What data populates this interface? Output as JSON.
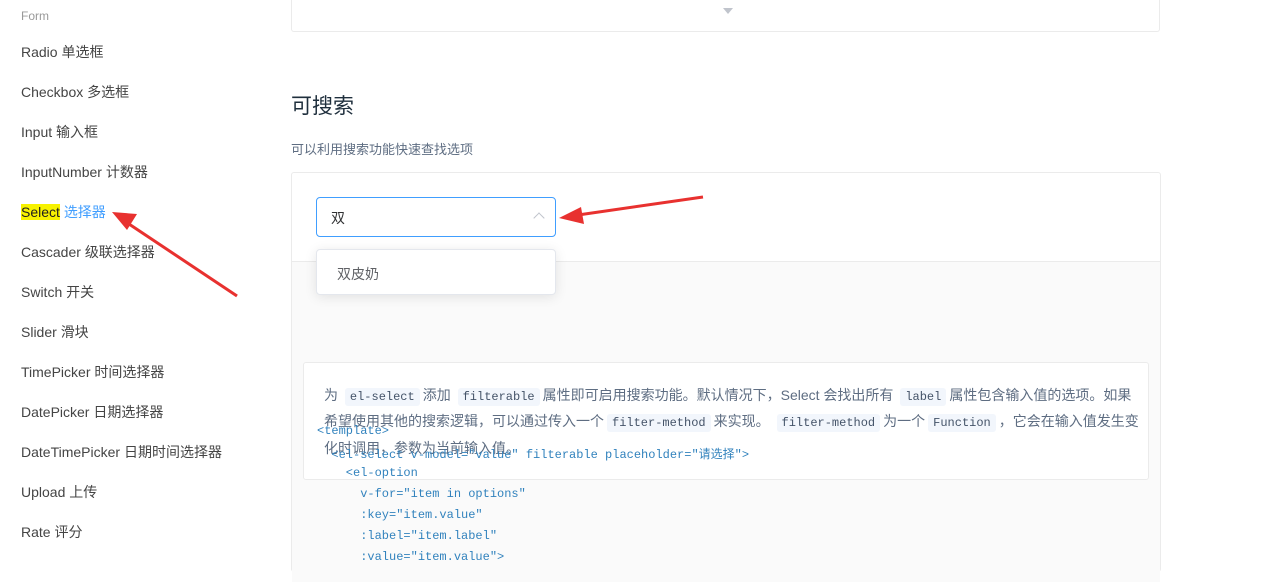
{
  "sidebar": {
    "group_title": "Form",
    "items": [
      {
        "en": "Radio",
        "cn": "单选框"
      },
      {
        "en": "Checkbox",
        "cn": "多选框"
      },
      {
        "en": "Input",
        "cn": "输入框"
      },
      {
        "en": "InputNumber",
        "cn": "计数器"
      },
      {
        "en": "Select",
        "cn": "选择器"
      },
      {
        "en": "Cascader",
        "cn": "级联选择器"
      },
      {
        "en": "Switch",
        "cn": "开关"
      },
      {
        "en": "Slider",
        "cn": "滑块"
      },
      {
        "en": "TimePicker",
        "cn": "时间选择器"
      },
      {
        "en": "DatePicker",
        "cn": "日期选择器"
      },
      {
        "en": "DateTimePicker",
        "cn": "日期时间选择器"
      },
      {
        "en": "Upload",
        "cn": "上传"
      },
      {
        "en": "Rate",
        "cn": "评分"
      }
    ],
    "active_index": 4
  },
  "section": {
    "title": "可搜索",
    "description": "可以利用搜索功能快速查找选项"
  },
  "select": {
    "value": "双",
    "arrow_icon": "chevron-up-icon",
    "dropdown_options": [
      "双皮奶"
    ]
  },
  "description_box": {
    "line1": {
      "t1": "为",
      "c1": "el-select",
      "t2": "添加",
      "c2": "filterable",
      "t3": "属性即可启用搜索功能。默认情况下，Select 会找出所有",
      "c3": "label",
      "t4": "属性包含输入值的选项。如果"
    },
    "line2": {
      "t1": "希望使用其他的搜索逻辑，可以通过传入一个",
      "c1": "filter-method",
      "t2": "来实现。",
      "c2": "filter-method",
      "t3": "为一个",
      "c3": "Function",
      "t4": "，它会在输入值发生变"
    },
    "line3": "化时调用，参数为当前输入值。"
  },
  "code": [
    "<template>",
    "  <el-select v-model=\"value\" filterable placeholder=\"请选择\">",
    "    <el-option",
    "      v-for=\"item in options\"",
    "      :key=\"item.value\"",
    "      :label=\"item.label\"",
    "      :value=\"item.value\">"
  ],
  "colors": {
    "accent": "#409eff",
    "highlight": "#f7f200",
    "annotation_arrow": "#e8312f"
  }
}
